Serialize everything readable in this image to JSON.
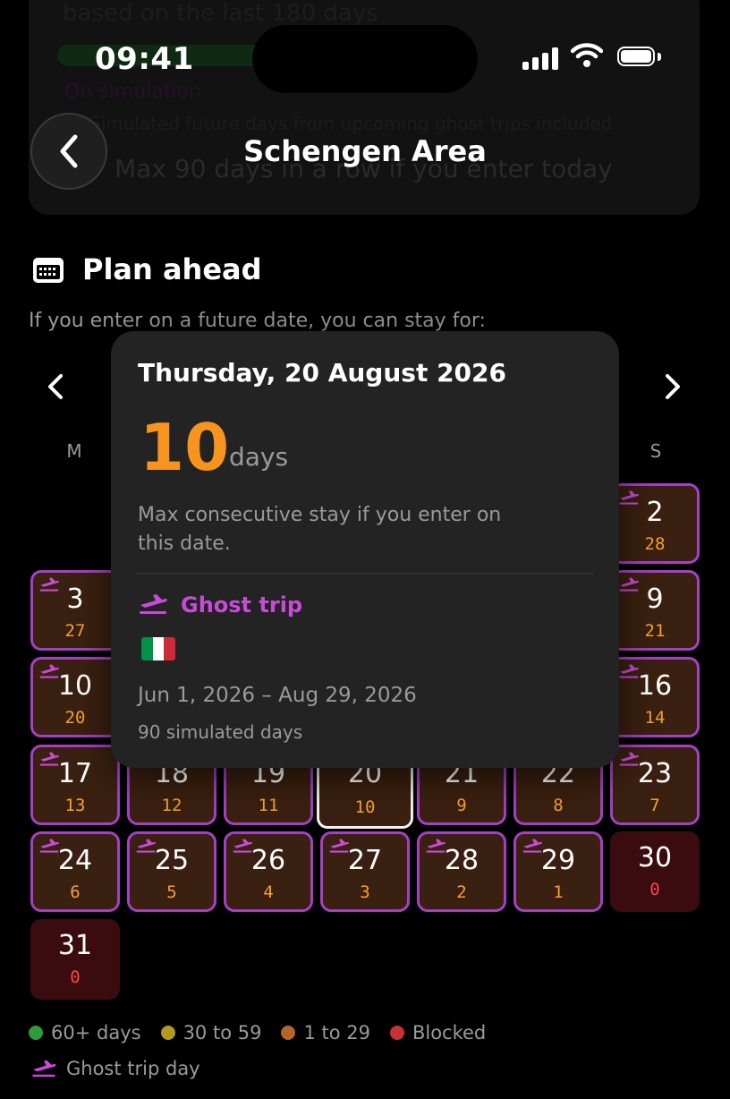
{
  "background": {
    "line1": "based on the last 180 days",
    "ghost": "On simulation",
    "line2": "Simulated future days from upcoming ghost trips included",
    "line3": "Max 90 days in a row if you enter today"
  },
  "status": {
    "time": "09:41"
  },
  "header": {
    "title": "Schengen Area"
  },
  "plan": {
    "title": "Plan ahead",
    "subtitle": "If you enter on a future date, you can stay for:"
  },
  "weekdays": {
    "mon": "M",
    "sun": "S"
  },
  "calendar": {
    "cells": [
      {
        "day": "2",
        "count": "28",
        "ghost": true
      },
      {
        "day": "3",
        "count": "27",
        "ghost": true
      },
      {
        "day": "9",
        "count": "21",
        "ghost": true
      },
      {
        "day": "10",
        "count": "20",
        "ghost": true
      },
      {
        "day": "16",
        "count": "14",
        "ghost": true
      },
      {
        "day": "17",
        "count": "13",
        "ghost": true
      },
      {
        "day": "18",
        "count": "12",
        "ghost": false
      },
      {
        "day": "19",
        "count": "11",
        "ghost": false
      },
      {
        "day": "20",
        "count": "10",
        "ghost": false,
        "selected": true
      },
      {
        "day": "21",
        "count": "9",
        "ghost": false
      },
      {
        "day": "22",
        "count": "8",
        "ghost": false
      },
      {
        "day": "23",
        "count": "7",
        "ghost": true
      },
      {
        "day": "24",
        "count": "6",
        "ghost": true
      },
      {
        "day": "25",
        "count": "5",
        "ghost": true
      },
      {
        "day": "26",
        "count": "4",
        "ghost": true
      },
      {
        "day": "27",
        "count": "3",
        "ghost": true
      },
      {
        "day": "28",
        "count": "2",
        "ghost": true
      },
      {
        "day": "29",
        "count": "1",
        "ghost": true
      },
      {
        "day": "30",
        "count": "0",
        "ghost": false,
        "blocked": true
      },
      {
        "day": "31",
        "count": "0",
        "ghost": false,
        "blocked": true
      }
    ]
  },
  "popover": {
    "date": "Thursday, 20 August 2026",
    "days_value": "10",
    "days_unit": "days",
    "description": "Max consecutive stay if you enter on this date.",
    "ghost_label": "Ghost trip",
    "flag_colors": [
      "#009246",
      "#ffffff",
      "#ce2b37"
    ],
    "range": "Jun 1, 2026 – Aug 29, 2026",
    "simulated": "90 simulated days"
  },
  "legend": {
    "items": [
      {
        "label": "60+ days",
        "color": "#2e9c3a"
      },
      {
        "label": "30 to 59",
        "color": "#b39a1c"
      },
      {
        "label": "1 to 29",
        "color": "#b5652a"
      },
      {
        "label": "Blocked",
        "color": "#c83232"
      }
    ],
    "ghost_day": "Ghost trip day"
  },
  "colors": {
    "ghost_purple": "#c84ad8",
    "count_orange": "#f5a035",
    "blocked_red": "#ff4444",
    "accent_orange": "#f7941d"
  }
}
